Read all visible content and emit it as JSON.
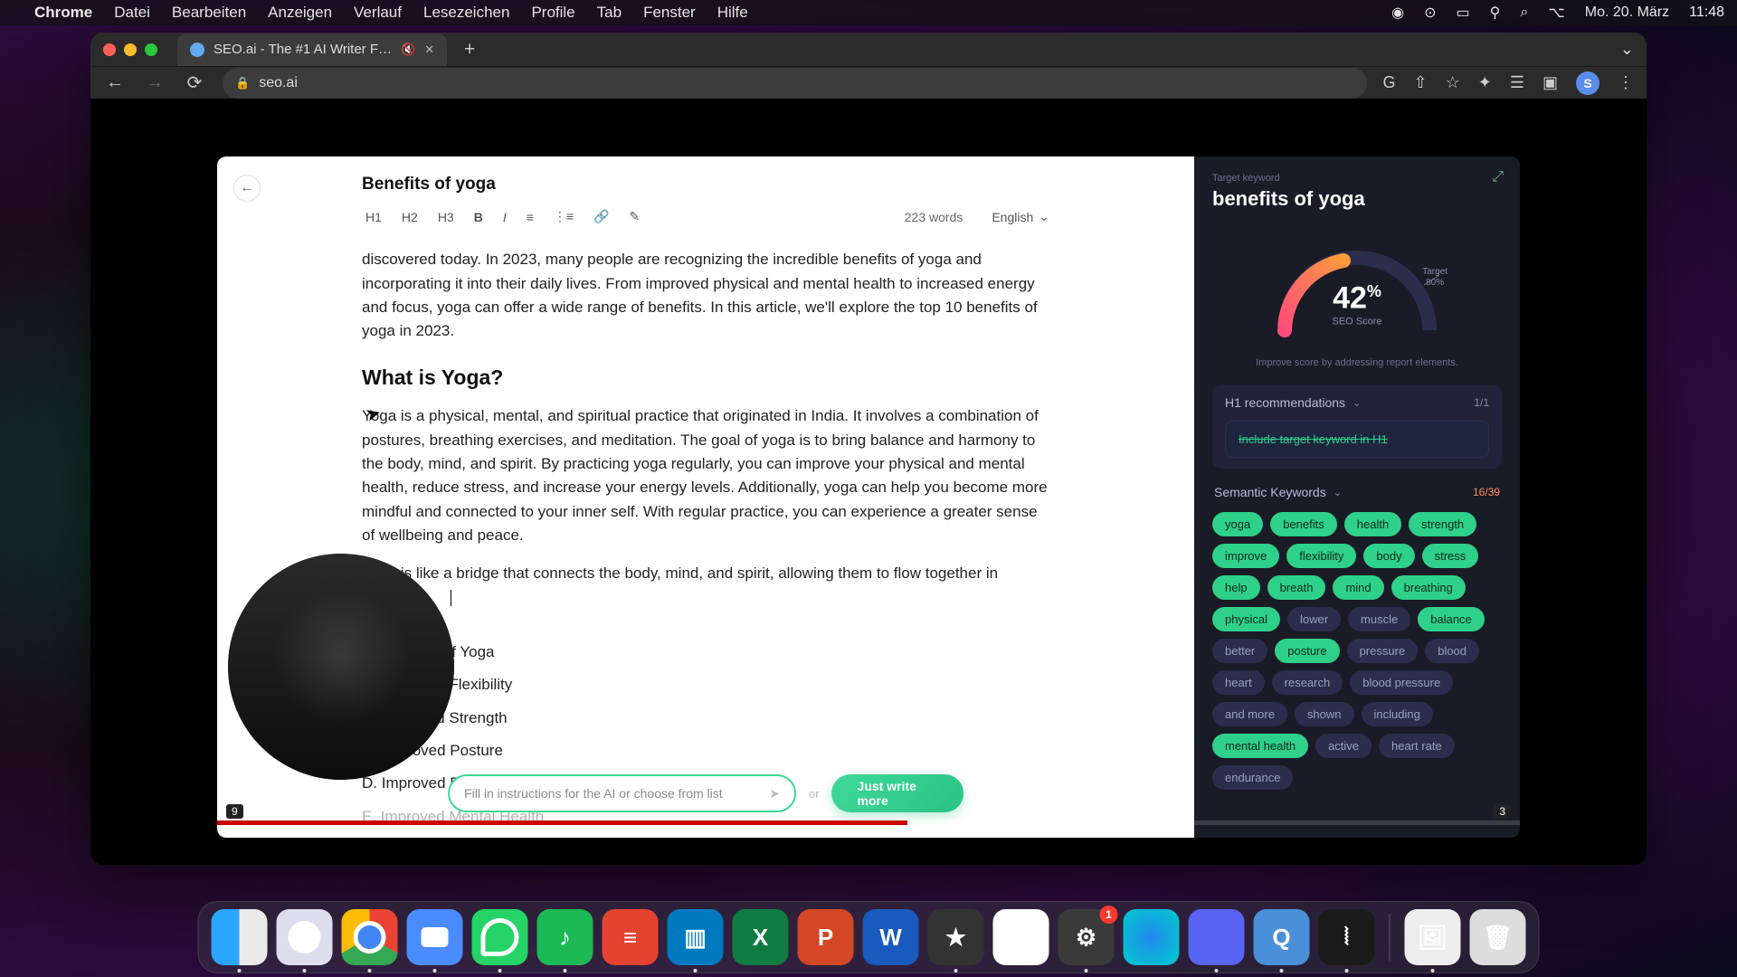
{
  "menubar": {
    "app_name": "Chrome",
    "menus": [
      "Datei",
      "Bearbeiten",
      "Anzeigen",
      "Verlauf",
      "Lesezeichen",
      "Profile",
      "Tab",
      "Fenster",
      "Hilfe"
    ],
    "date": "Mo. 20. März",
    "time": "11:48"
  },
  "browser": {
    "tab_title": "SEO.ai - The #1 AI Writer F…",
    "url": "seo.ai",
    "profile_letter": "S"
  },
  "editor": {
    "title": "Benefits of yoga",
    "toolbar": {
      "h1": "H1",
      "h2": "H2",
      "h3": "H3",
      "bold": "B",
      "italic": "I"
    },
    "word_count": "223 words",
    "language": "English",
    "p1": "discovered today. In 2023, many people are recognizing the incredible benefits of yoga and incorporating it into their daily lives. From improved physical and mental health to increased energy and focus, yoga can offer a wide range of benefits. In this article, we'll explore the top 10 benefits of yoga in 2023.",
    "h2_1": "What is Yoga?",
    "p2": "Yoga is a physical, mental, and spiritual practice that originated in India. It involves a combination of postures, breathing exercises, and meditation. The goal of yoga is to bring balance and harmony to the body, mind, and spirit. By practicing yoga regularly, you can improve your physical and mental health, reduce stress, and increase your energy levels. Additionally, yoga can help you become more mindful and connected to your inner self. With regular practice, you can experience a greater sense of wellbeing and peace.",
    "p3": "Yoga is like a bridge that connects the body, mind, and spirit, allowing them to flow together in harmony.",
    "outline": [
      "III. Benefits of Yoga",
      "A. Improved Flexibility",
      "B. Improved Strength",
      "C. Improved Posture",
      "D. Improved Balance",
      "E. Improved Mental Health"
    ],
    "ai_placeholder": "Fill in instructions for the AI or choose from list",
    "ai_or": "or",
    "ai_button": "Just write more"
  },
  "sidebar": {
    "target_kw_label": "Target keyword",
    "target_kw": "benefits of yoga",
    "score": "42",
    "score_unit": "%",
    "score_label": "SEO Score",
    "target_label": "Target",
    "target_value": "80%",
    "gauge_hint": "Improve score by addressing report elements.",
    "h1_section": {
      "title": "H1 recommendations",
      "count": "1/1",
      "item": "Include target keyword in H1"
    },
    "semantic": {
      "title": "Semantic Keywords",
      "count": "16/39",
      "keywords": [
        {
          "w": "yoga",
          "d": true
        },
        {
          "w": "benefits",
          "d": true
        },
        {
          "w": "health",
          "d": true
        },
        {
          "w": "strength",
          "d": true
        },
        {
          "w": "improve",
          "d": true
        },
        {
          "w": "flexibility",
          "d": true
        },
        {
          "w": "body",
          "d": true
        },
        {
          "w": "stress",
          "d": true
        },
        {
          "w": "help",
          "d": true
        },
        {
          "w": "breath",
          "d": true
        },
        {
          "w": "mind",
          "d": true
        },
        {
          "w": "breathing",
          "d": true
        },
        {
          "w": "physical",
          "d": true
        },
        {
          "w": "lower",
          "d": false
        },
        {
          "w": "muscle",
          "d": false
        },
        {
          "w": "balance",
          "d": true
        },
        {
          "w": "better",
          "d": false
        },
        {
          "w": "posture",
          "d": true
        },
        {
          "w": "pressure",
          "d": false
        },
        {
          "w": "blood",
          "d": false
        },
        {
          "w": "heart",
          "d": false
        },
        {
          "w": "research",
          "d": false
        },
        {
          "w": "blood pressure",
          "d": false
        },
        {
          "w": "and more",
          "d": false
        },
        {
          "w": "shown",
          "d": false
        },
        {
          "w": "including",
          "d": false
        },
        {
          "w": "mental health",
          "d": true
        },
        {
          "w": "active",
          "d": false
        },
        {
          "w": "heart rate",
          "d": false
        },
        {
          "w": "endurance",
          "d": false
        }
      ]
    }
  },
  "video_overlay": {
    "left_label": "9",
    "right_label": "3"
  },
  "dock": {
    "items": [
      {
        "name": "finder",
        "cls": "di-finder",
        "glyph": ""
      },
      {
        "name": "safari",
        "cls": "di-safari",
        "glyph": ""
      },
      {
        "name": "chrome",
        "cls": "di-chrome",
        "glyph": ""
      },
      {
        "name": "zoom",
        "cls": "di-zoom",
        "glyph": ""
      },
      {
        "name": "whatsapp",
        "cls": "di-whatsapp",
        "glyph": ""
      },
      {
        "name": "spotify",
        "cls": "di-spotify",
        "glyph": "♪"
      },
      {
        "name": "todoist",
        "cls": "di-todoist",
        "glyph": "≡"
      },
      {
        "name": "trello",
        "cls": "di-trello",
        "glyph": "▥"
      },
      {
        "name": "excel",
        "cls": "di-excel",
        "glyph": "X"
      },
      {
        "name": "powerpoint",
        "cls": "di-ppt",
        "glyph": "P"
      },
      {
        "name": "word",
        "cls": "di-word",
        "glyph": "W"
      },
      {
        "name": "imovie",
        "cls": "di-imovie",
        "glyph": "★"
      },
      {
        "name": "drive",
        "cls": "di-drive",
        "glyph": "▲"
      },
      {
        "name": "settings",
        "cls": "di-settings",
        "glyph": "⚙",
        "badge": "1"
      },
      {
        "name": "siri",
        "cls": "di-siri",
        "glyph": ""
      },
      {
        "name": "discord",
        "cls": "di-discord",
        "glyph": ""
      },
      {
        "name": "quicktime",
        "cls": "di-qt",
        "glyph": "Q"
      },
      {
        "name": "voice-memos",
        "cls": "di-wave",
        "glyph": "⦚"
      }
    ],
    "right_items": [
      {
        "name": "preview",
        "cls": "di-preview",
        "glyph": "🖼"
      },
      {
        "name": "trash",
        "cls": "di-trash",
        "glyph": "🗑"
      }
    ],
    "running": [
      "finder",
      "safari",
      "chrome",
      "zoom",
      "whatsapp",
      "spotify",
      "trello",
      "imovie",
      "settings",
      "discord",
      "quicktime",
      "voice-memos",
      "preview"
    ]
  }
}
